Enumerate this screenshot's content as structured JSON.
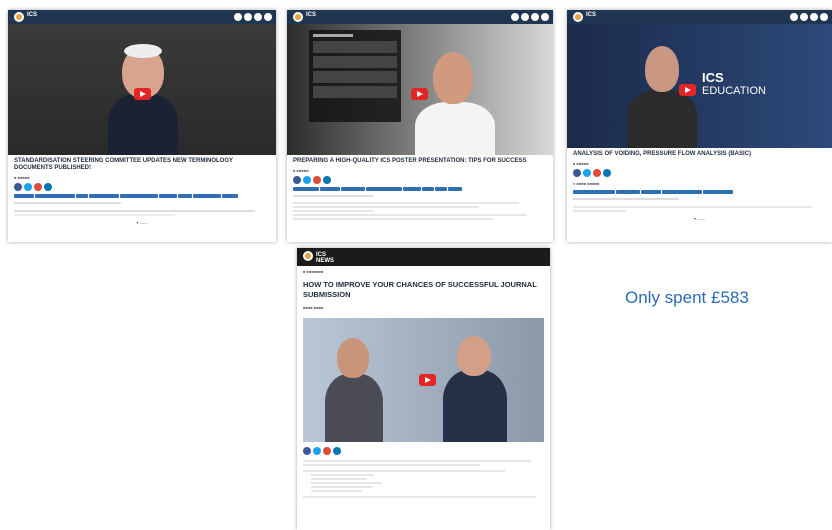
{
  "app": {
    "brand": "ICS",
    "brand_sub": "TV",
    "news_brand": "ICS NEWS"
  },
  "cards": [
    {
      "title": "STANDARDISATION STEERING COMMITTEE UPDATES NEW TERMINOLOGY DOCUMENTS PUBLISHED!",
      "brand_color": "#1f3550"
    },
    {
      "title": "PREPARING A HIGH-QUALITY ICS POSTER PRESENTATION: TIPS FOR SUCCESS",
      "brand_color": "#1f3550"
    },
    {
      "title": "ANALYSIS OF VOIDING, PRESSURE FLOW ANALYSIS (BASIC)",
      "overlay": "ICS",
      "overlay_sub": "EDUCATION"
    }
  ],
  "news": {
    "title": "HOW TO IMPROVE YOUR CHANCES OF SUCCESSFUL JOURNAL SUBMISSION"
  },
  "caption": "Only spent £583",
  "colors": {
    "accent": "#2b6bb5",
    "play": "#e52525",
    "topbar": "#1f3550"
  }
}
